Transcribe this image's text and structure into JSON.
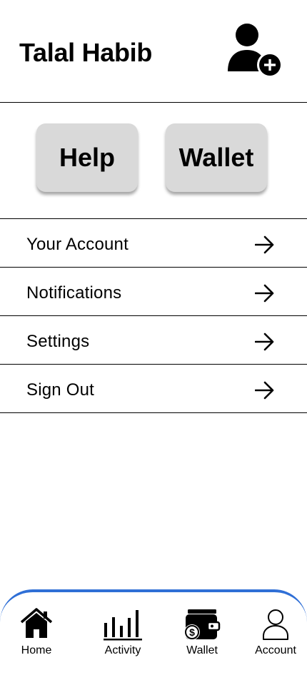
{
  "header": {
    "user_name": "Talal Habib",
    "add_user_icon": "add-user-icon"
  },
  "quick_actions": {
    "help_label": "Help",
    "wallet_label": "Wallet"
  },
  "menu": {
    "items": [
      {
        "label": "Your Account",
        "icon": "arrow-right-icon"
      },
      {
        "label": "Notifications",
        "icon": "arrow-right-icon"
      },
      {
        "label": "Settings",
        "icon": "arrow-right-icon"
      },
      {
        "label": "Sign Out",
        "icon": "arrow-right-icon"
      }
    ]
  },
  "bottom_nav": {
    "accent_color": "#2f6fd6",
    "items": [
      {
        "label": "Home",
        "icon": "home-icon"
      },
      {
        "label": "Activity",
        "icon": "activity-icon"
      },
      {
        "label": "Wallet",
        "icon": "wallet-icon"
      },
      {
        "label": "Account",
        "icon": "account-icon"
      }
    ]
  }
}
